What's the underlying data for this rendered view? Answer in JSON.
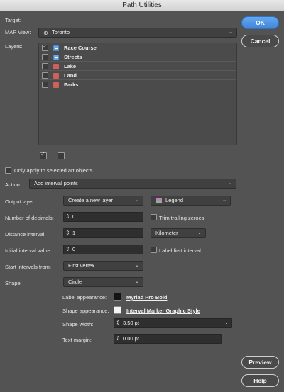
{
  "window": {
    "title": "Path Utilities"
  },
  "buttons": {
    "ok": "OK",
    "cancel": "Cancel",
    "preview": "Preview",
    "help": "Help"
  },
  "target": {
    "label": "Target:"
  },
  "map_view": {
    "label": "MAP View:",
    "value": "Toronto"
  },
  "layers": {
    "label": "Layers:",
    "items": [
      {
        "name": "Race Course",
        "checked": true,
        "swatch": "#6fa8e6"
      },
      {
        "name": "Streets",
        "checked": false,
        "swatch": "#6fa8e6"
      },
      {
        "name": "Lake",
        "checked": false,
        "swatch": "#d0605a"
      },
      {
        "name": "Land",
        "checked": false,
        "swatch": "#d0605a"
      },
      {
        "name": "Parks",
        "checked": false,
        "swatch": "#d0605a"
      }
    ]
  },
  "only_selected": {
    "label": "Only apply to selected art objects"
  },
  "action": {
    "label": "Action:",
    "value": "Add interval points"
  },
  "output_layer": {
    "label": "Output layer",
    "mode": "Create a new layer",
    "layer_name": "Legend"
  },
  "decimals": {
    "label": "Number of decimals:",
    "value": "0",
    "trim_label": "Trim trailing zeroes"
  },
  "distance": {
    "label": "Distance interval:",
    "value": "1",
    "unit": "Kilometer"
  },
  "initial": {
    "label": "Initial interval value:",
    "value": "0",
    "first_label": "Label first interval"
  },
  "start_from": {
    "label": "Start intervals from:",
    "value": "First vertex"
  },
  "shape": {
    "label": "Shape:",
    "value": "Circle"
  },
  "label_appearance": {
    "label": "Label appearance:",
    "value": "Myriad Pro Bold",
    "chip_color": "#141414"
  },
  "shape_appearance": {
    "label": "Shape appearance:",
    "value": "Interval Marker Graphic Style",
    "chip_color": "#f5f5f5"
  },
  "shape_width": {
    "label": "Shape width:",
    "value": "3.50 pt"
  },
  "text_margin": {
    "label": "Text margin:",
    "value": "0.00 pt"
  },
  "colors": {
    "background": "#535353",
    "accent": "#4f94e3"
  }
}
